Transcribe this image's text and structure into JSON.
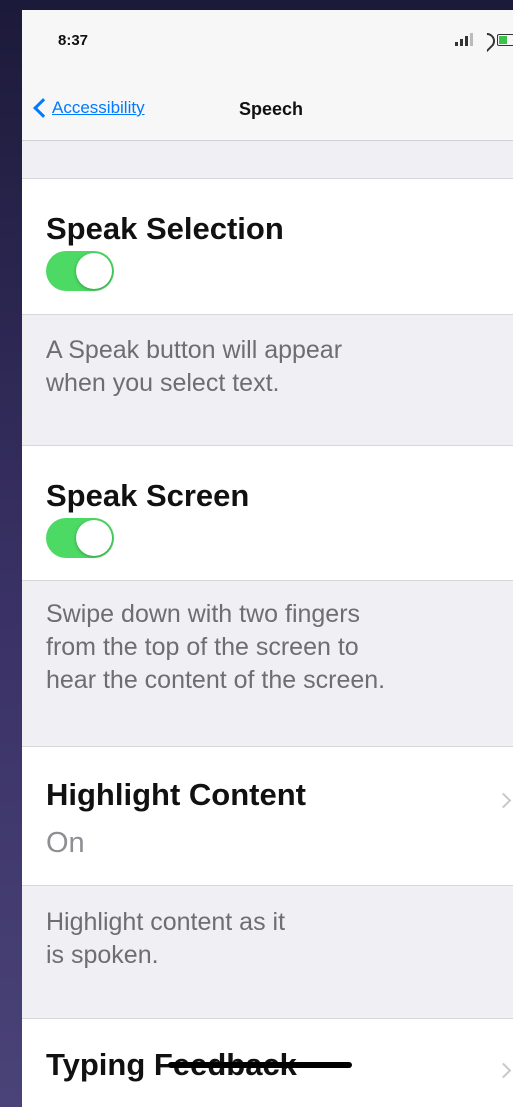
{
  "status_bar": {
    "time": "8:37",
    "icons": [
      "signal-icon",
      "wifi-icon",
      "battery-icon"
    ]
  },
  "nav": {
    "back_label": "Accessibility",
    "title": "Speech"
  },
  "settings": {
    "speak_selection": {
      "title": "Speak Selection",
      "toggle_on": true,
      "footer": [
        "A Speak button will appear",
        "when you select text."
      ]
    },
    "speak_screen": {
      "title": "Speak Screen",
      "toggle_on": true,
      "footer": [
        "Swipe down with two fingers",
        "from the top of the screen to",
        "hear the content of the screen."
      ]
    },
    "highlight_content": {
      "title": "Highlight Content",
      "value": "On",
      "footer": [
        "Highlight content as it",
        "is spoken."
      ]
    },
    "typing_feedback": {
      "title": "Typing Feedback"
    }
  },
  "colors": {
    "accent": "#007aff",
    "toggle_on": "#4cd964",
    "background": "#efeff4"
  }
}
